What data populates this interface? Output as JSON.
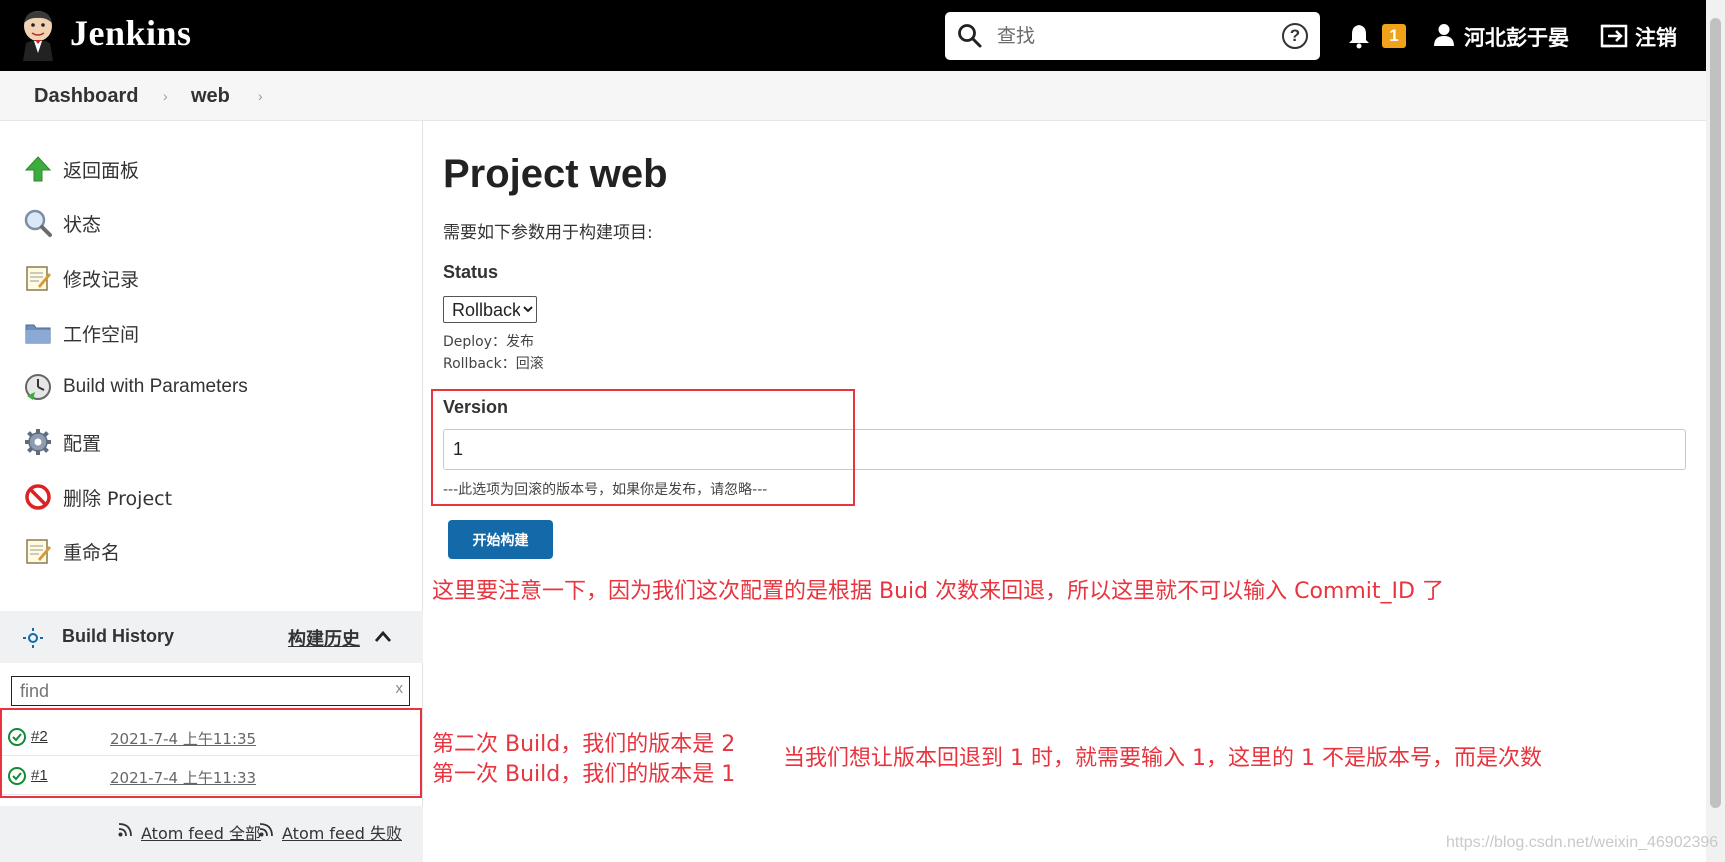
{
  "header": {
    "brand": "Jenkins",
    "search_placeholder": "查找",
    "help_symbol": "?",
    "notification_count": "1",
    "user_name": "河北彭于晏",
    "logout_label": "注销"
  },
  "breadcrumb": {
    "items": [
      "Dashboard",
      "web"
    ]
  },
  "sidebar": {
    "tasks": [
      {
        "label": "返回面板",
        "icon": "up-arrow-icon"
      },
      {
        "label": "状态",
        "icon": "magnifier-icon"
      },
      {
        "label": "修改记录",
        "icon": "notepad-icon"
      },
      {
        "label": "工作空间",
        "icon": "folder-icon"
      },
      {
        "label": "Build with Parameters",
        "icon": "clock-icon"
      },
      {
        "label": "配置",
        "icon": "gear-icon"
      },
      {
        "label": "删除 Project",
        "icon": "no-entry-icon"
      },
      {
        "label": "重命名",
        "icon": "notepad-icon"
      }
    ],
    "build_history": {
      "title": "Build History",
      "trend_label": "构建历史",
      "find_placeholder": "find",
      "clear": "x",
      "builds": [
        {
          "number": "#2",
          "date": "2021-7-4 上午11:35"
        },
        {
          "number": "#1",
          "date": "2021-7-4 上午11:33"
        }
      ],
      "feed_all": "Atom feed 全部",
      "feed_failed": "Atom feed 失败"
    }
  },
  "main": {
    "title": "Project web",
    "description": "需要如下参数用于构建项目:",
    "status": {
      "label": "Status",
      "selected": "Rollback",
      "help_deploy": "Deploy：发布",
      "help_rollback": "Rollback：回滚"
    },
    "version": {
      "label": "Version",
      "value": "1",
      "help": "---此选项为回滚的版本号，如果你是发布，请忽略---"
    },
    "build_button": "开始构建"
  },
  "annotations": {
    "note_main": "这里要注意一下，因为我们这次配置的是根据 Buid 次数来回退，所以这里就不可以输入 Commit_ID 了",
    "note_build2": "第二次 Build，我们的版本是 2",
    "note_build1": "第一次 Build，我们的版本是 1",
    "note_rollback": "当我们想让版本回退到 1 时，就需要输入 1，这里的 1 不是版本号，而是次数",
    "color": "#e8343e"
  },
  "watermark": "https://blog.csdn.net/weixin_46902396",
  "colors": {
    "header_bg": "#000000",
    "build_button": "#1469a8",
    "badge": "#f0a21b",
    "success": "#138a36"
  }
}
